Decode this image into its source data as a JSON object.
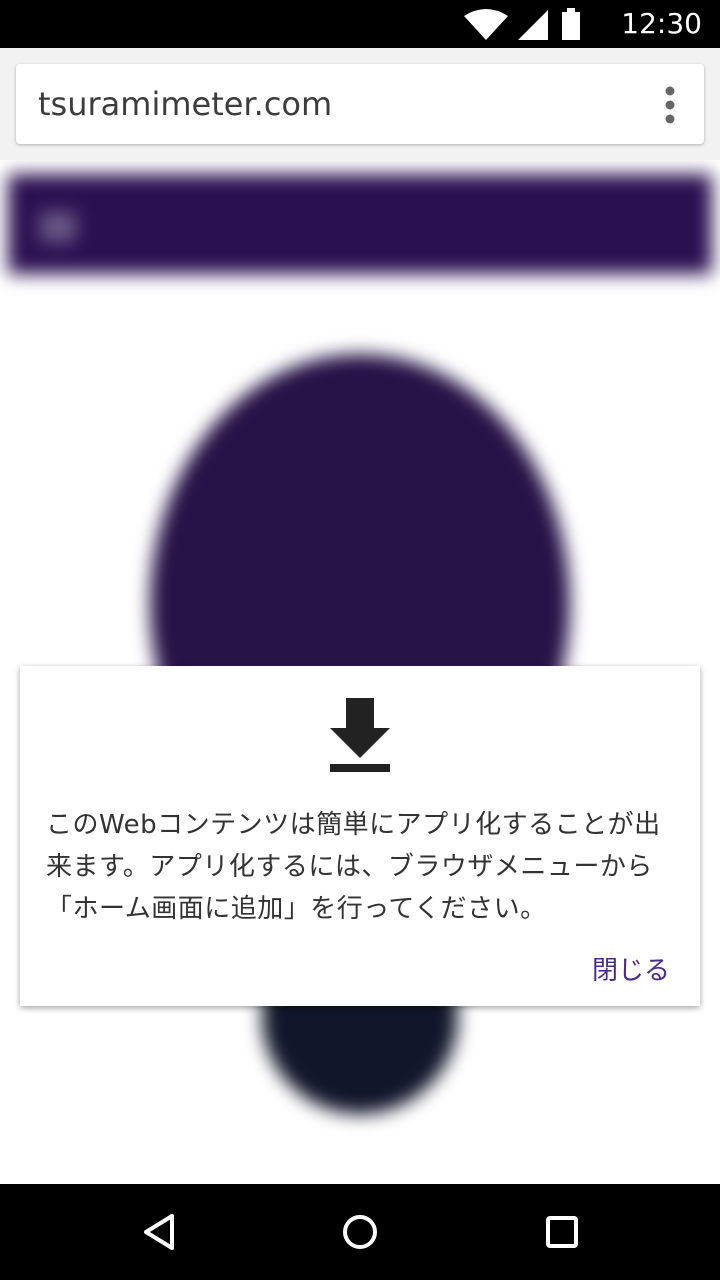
{
  "status_bar": {
    "time": "12:30",
    "icons": [
      "wifi-icon",
      "signal-icon",
      "battery-icon"
    ]
  },
  "browser": {
    "url": "tsuramimeter.com",
    "menu_icon": "overflow-menu-icon"
  },
  "dialog": {
    "icon": "download-icon",
    "message": "このWebコンテンツは簡単にアプリ化することが出来ます。アプリ化するには、ブラウザメニューから「ホーム画面に追加」を行ってください。",
    "close_label": "閉じる"
  },
  "nav_bar": {
    "buttons": [
      "back-icon",
      "home-icon",
      "recents-icon"
    ]
  },
  "colors": {
    "header": "#2b1050",
    "accent": "#4a2c8a",
    "circle_dark": "#12162a"
  }
}
